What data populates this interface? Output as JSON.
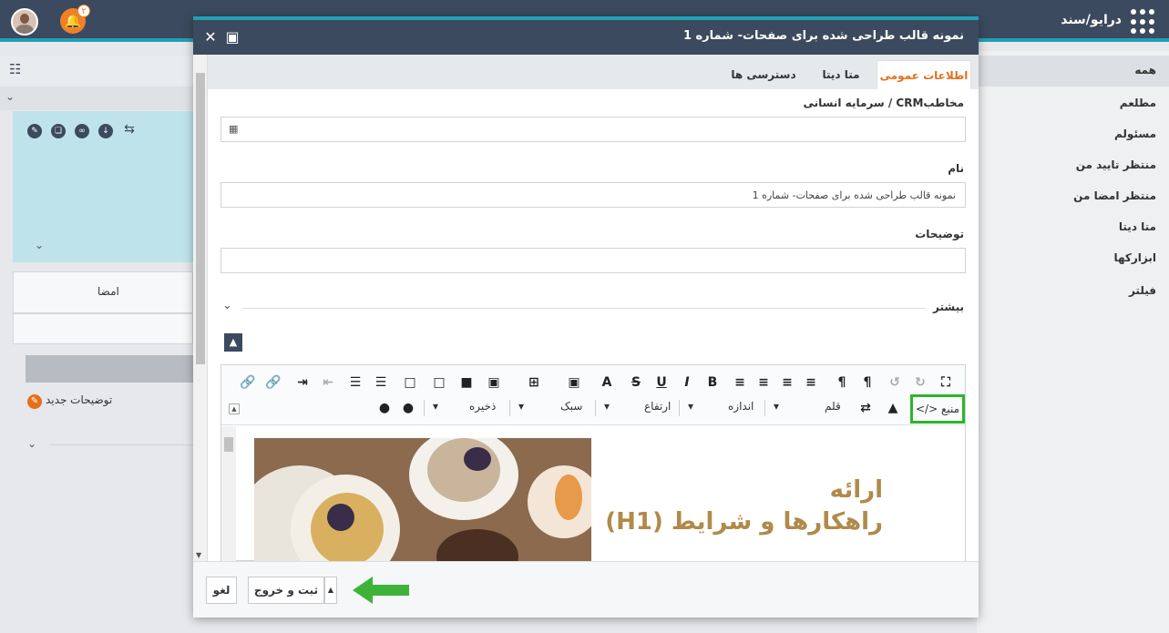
{
  "topbar": {
    "brand": "درایو/سند",
    "notification_count": "۲"
  },
  "right_nav": {
    "items": [
      "همه",
      "مطلعم",
      "مسئولم",
      "منتظر تایید من",
      "منتظر امضا من",
      "متا دیتا",
      "ابزارکها",
      "فیلتر"
    ]
  },
  "left_panel": {
    "sign_label": "امضا",
    "new_note": "توضیحات جدید"
  },
  "dialog": {
    "title": "نمونه قالب طراحی شده برای صفحات- شماره 1",
    "tabs": [
      "اطلاعات عمومی",
      "متا دیتا",
      "دسترسی ها"
    ],
    "contact_label": "مخاطبCRM / سرمایه انسانی",
    "name_label": "نام",
    "name_value": "نمونه قالب طراحی شده برای صفحات- شماره 1",
    "desc_label": "توضیحات",
    "more_label": "بیشتر",
    "toolbar": {
      "source": "منبع",
      "font": "قلم",
      "size": "اندازه",
      "height": "ارتفاع",
      "style": "سبک",
      "save": "ذخیره"
    },
    "content": {
      "line1": "ارائه",
      "line2": "راهکارها و شرایط (H1)"
    },
    "footer": {
      "submit_exit": "ثبت و خروج",
      "cancel": "لغو"
    }
  },
  "colors": {
    "header": "#3b4a5e",
    "accent": "#21a0b6",
    "active_tab": "#e3701a",
    "highlight": "#2db52b",
    "bell": "#f07f2a"
  }
}
